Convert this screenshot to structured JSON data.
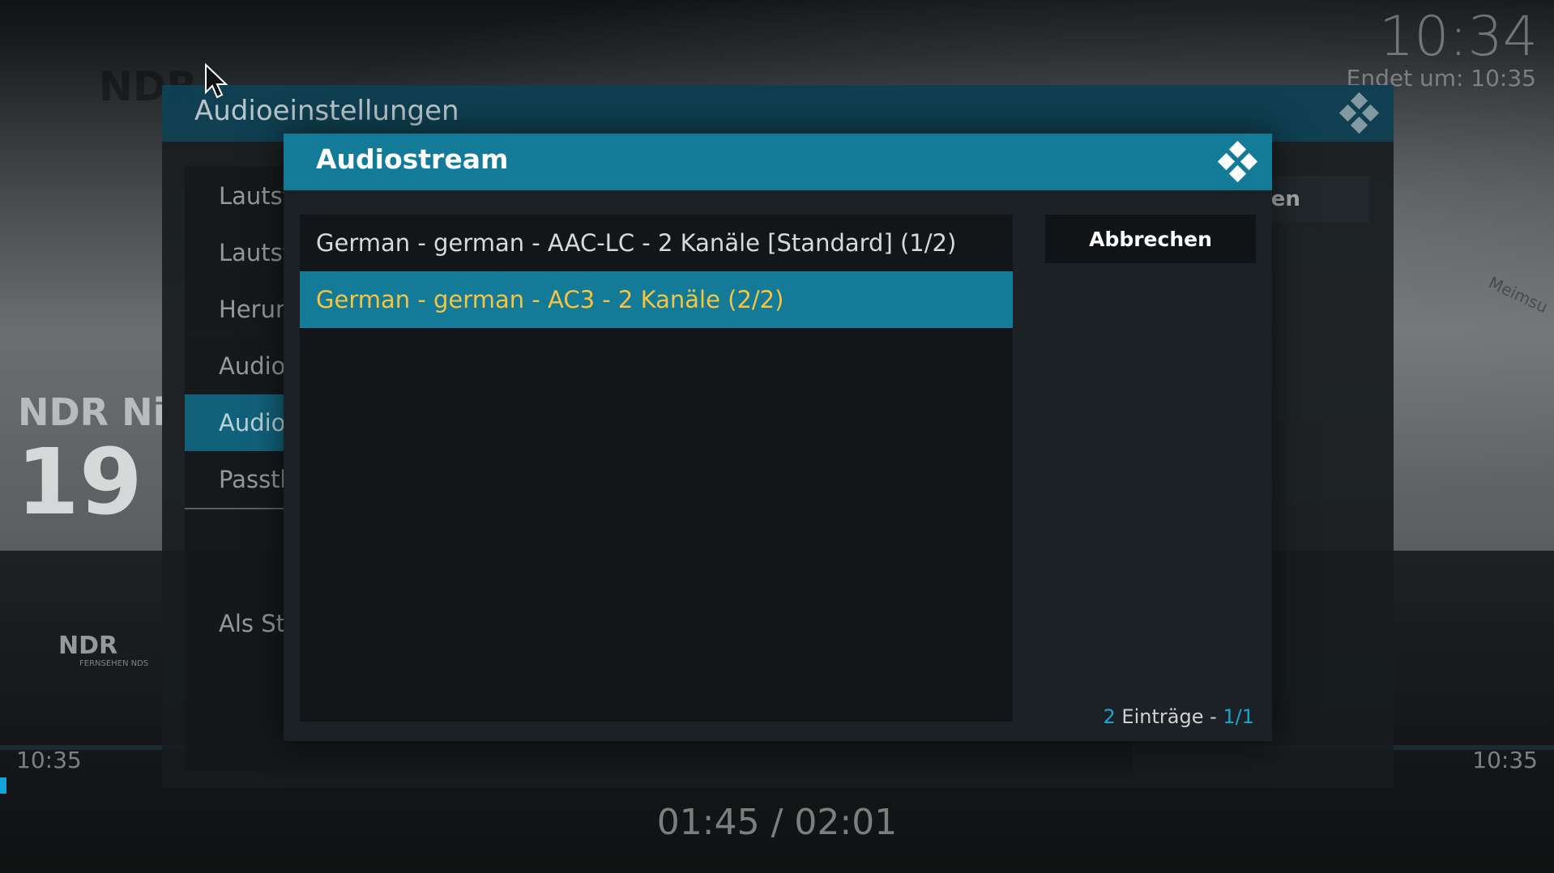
{
  "background": {
    "channel_logo": "NDR",
    "channel_name": "NDR Ni",
    "channel_number": "19",
    "small_logo": "NDR",
    "small_logo_sub": "FERNSEHEN NDS",
    "epg_time_left": "10:35",
    "epg_time_right": "10:35",
    "map_label": "Meimsu"
  },
  "clock": {
    "time": "10:34",
    "ends_label": "Endet um: 10:35"
  },
  "playback": {
    "position": "01:45 / 02:01"
  },
  "outer_dialog": {
    "title": "Audioeinstellungen",
    "menu": [
      {
        "label": "Lautst"
      },
      {
        "label": "Lautst"
      },
      {
        "label": "Herun"
      },
      {
        "label": "Audio"
      },
      {
        "label": "Audios",
        "selected": true
      },
      {
        "label": "Passth"
      }
    ],
    "extra_item": "Als Sta",
    "close_button": "ßen",
    "icon": "kodi-logo-icon"
  },
  "inner_dialog": {
    "title": "Audiostream",
    "icon": "kodi-logo-icon",
    "items": [
      {
        "label": "German - german - AAC-LC  - 2 Kanäle [Standard] (1/2)"
      },
      {
        "label": "German - german - AC3  - 2 Kanäle (2/2)",
        "focused": true
      }
    ],
    "cancel_label": "Abbrechen",
    "count_number": "2",
    "count_text": " Einträge - ",
    "count_page": "1/1"
  },
  "colors": {
    "accent": "#137a98",
    "focused_text": "#f5c542",
    "count_highlight": "#16a6d6"
  }
}
